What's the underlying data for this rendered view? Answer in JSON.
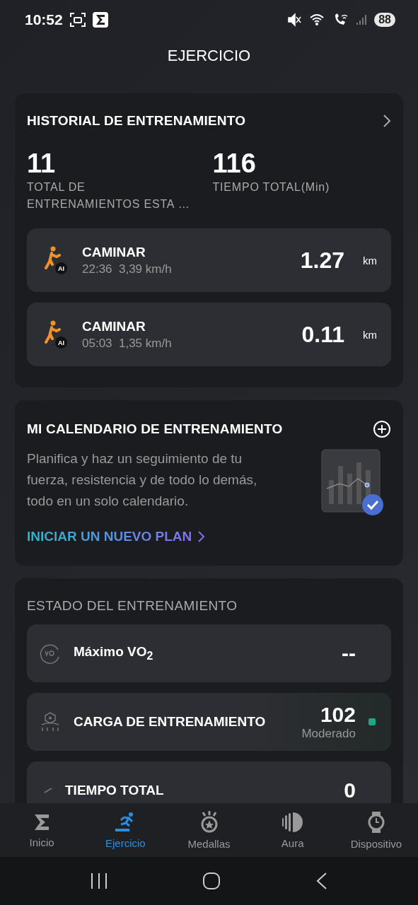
{
  "status_bar": {
    "time": "10:52",
    "battery": "88"
  },
  "header": {
    "title": "EJERCICIO"
  },
  "history": {
    "title": "HISTORIAL DE ENTRENAMIENTO",
    "stats": [
      {
        "value": "11",
        "label": "TOTAL DE ENTRENAMIENTOS ESTA …"
      },
      {
        "value": "116",
        "label": "TIEMPO TOTAL(Min)"
      }
    ],
    "workouts": [
      {
        "name": "CAMINAR",
        "details": "22:36  3,39 km/h",
        "badge": "AI",
        "distance": "1.27",
        "unit": "km"
      },
      {
        "name": "CAMINAR",
        "details": "05:03  1,35 km/h",
        "badge": "AI",
        "distance": "0.11",
        "unit": "km"
      }
    ]
  },
  "calendar": {
    "title": "MI CALENDARIO DE ENTRENAMIENTO",
    "description": "Planifica y haz un seguimiento de tu fuerza, resistencia y de todo lo demás, todo en un solo calendario.",
    "link": "INICIAR UN NUEVO PLAN"
  },
  "training_status": {
    "title": "ESTADO DEL ENTRENAMIENTO",
    "items": [
      {
        "kind": "vo2",
        "label": "Máximo VO$_{2}$",
        "value": "--"
      },
      {
        "kind": "load",
        "label": "CARGA DE ENTRENAMIENTO",
        "value": "102",
        "sublabel": "Moderado",
        "color": "#1fa785"
      },
      {
        "kind": "time",
        "label": "TIEMPO TOTAL",
        "value": "0"
      }
    ]
  },
  "tabs": [
    {
      "kind": "home",
      "label": "Inicio",
      "selected": false
    },
    {
      "kind": "exercise",
      "label": "Ejercicio",
      "selected": true
    },
    {
      "kind": "medals",
      "label": "Medallas",
      "selected": false
    },
    {
      "kind": "aura",
      "label": "Aura",
      "selected": false
    },
    {
      "kind": "device",
      "label": "Dispositivo",
      "selected": false
    }
  ]
}
